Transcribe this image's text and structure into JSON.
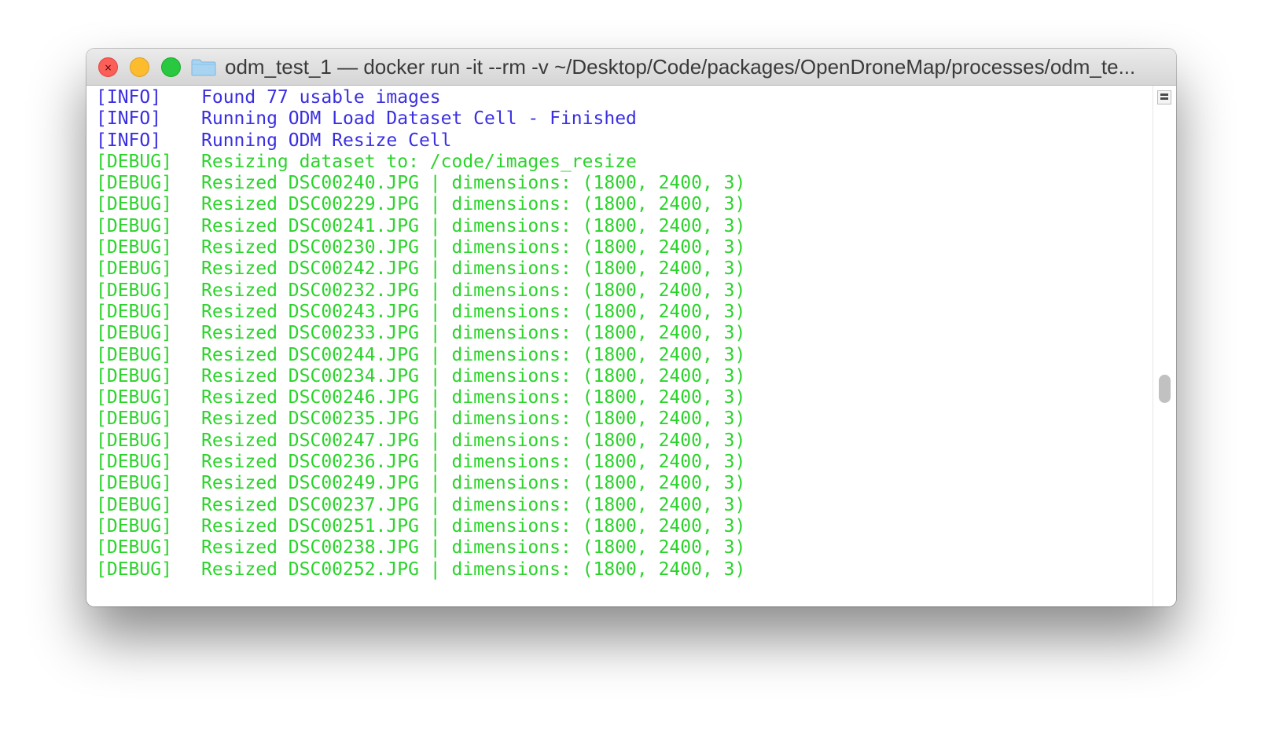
{
  "window": {
    "title": "odm_test_1 — docker run -it --rm -v ~/Desktop/Code/packages/OpenDroneMap/processes/odm_te...",
    "close_glyph": "×"
  },
  "colors": {
    "info": "#3a2fe0",
    "debug": "#2bd42b",
    "titlebar_text": "#3a3a3a",
    "folder": "#9fd0f0"
  },
  "icons": {
    "close": "close-icon",
    "minimize": "minimize-icon",
    "zoom": "zoom-icon",
    "folder": "folder-icon",
    "split": "split-pane-icon"
  },
  "terminal": {
    "lines": [
      {
        "level": "[INFO]",
        "message": "Found 77 usable images",
        "kind": "info"
      },
      {
        "level": "[INFO]",
        "message": "Running ODM Load Dataset Cell - Finished",
        "kind": "info"
      },
      {
        "level": "[INFO]",
        "message": "Running ODM Resize Cell",
        "kind": "info"
      },
      {
        "level": "[DEBUG]",
        "message": "Resizing dataset to: /code/images_resize",
        "kind": "debug"
      },
      {
        "level": "[DEBUG]",
        "message": "Resized DSC00240.JPG | dimensions: (1800, 2400, 3)",
        "kind": "debug"
      },
      {
        "level": "[DEBUG]",
        "message": "Resized DSC00229.JPG | dimensions: (1800, 2400, 3)",
        "kind": "debug"
      },
      {
        "level": "[DEBUG]",
        "message": "Resized DSC00241.JPG | dimensions: (1800, 2400, 3)",
        "kind": "debug"
      },
      {
        "level": "[DEBUG]",
        "message": "Resized DSC00230.JPG | dimensions: (1800, 2400, 3)",
        "kind": "debug"
      },
      {
        "level": "[DEBUG]",
        "message": "Resized DSC00242.JPG | dimensions: (1800, 2400, 3)",
        "kind": "debug"
      },
      {
        "level": "[DEBUG]",
        "message": "Resized DSC00232.JPG | dimensions: (1800, 2400, 3)",
        "kind": "debug"
      },
      {
        "level": "[DEBUG]",
        "message": "Resized DSC00243.JPG | dimensions: (1800, 2400, 3)",
        "kind": "debug"
      },
      {
        "level": "[DEBUG]",
        "message": "Resized DSC00233.JPG | dimensions: (1800, 2400, 3)",
        "kind": "debug"
      },
      {
        "level": "[DEBUG]",
        "message": "Resized DSC00244.JPG | dimensions: (1800, 2400, 3)",
        "kind": "debug"
      },
      {
        "level": "[DEBUG]",
        "message": "Resized DSC00234.JPG | dimensions: (1800, 2400, 3)",
        "kind": "debug"
      },
      {
        "level": "[DEBUG]",
        "message": "Resized DSC00246.JPG | dimensions: (1800, 2400, 3)",
        "kind": "debug"
      },
      {
        "level": "[DEBUG]",
        "message": "Resized DSC00235.JPG | dimensions: (1800, 2400, 3)",
        "kind": "debug"
      },
      {
        "level": "[DEBUG]",
        "message": "Resized DSC00247.JPG | dimensions: (1800, 2400, 3)",
        "kind": "debug"
      },
      {
        "level": "[DEBUG]",
        "message": "Resized DSC00236.JPG | dimensions: (1800, 2400, 3)",
        "kind": "debug"
      },
      {
        "level": "[DEBUG]",
        "message": "Resized DSC00249.JPG | dimensions: (1800, 2400, 3)",
        "kind": "debug"
      },
      {
        "level": "[DEBUG]",
        "message": "Resized DSC00237.JPG | dimensions: (1800, 2400, 3)",
        "kind": "debug"
      },
      {
        "level": "[DEBUG]",
        "message": "Resized DSC00251.JPG | dimensions: (1800, 2400, 3)",
        "kind": "debug"
      },
      {
        "level": "[DEBUG]",
        "message": "Resized DSC00238.JPG | dimensions: (1800, 2400, 3)",
        "kind": "debug"
      },
      {
        "level": "[DEBUG]",
        "message": "Resized DSC00252.JPG | dimensions: (1800, 2400, 3)",
        "kind": "debug"
      }
    ]
  }
}
